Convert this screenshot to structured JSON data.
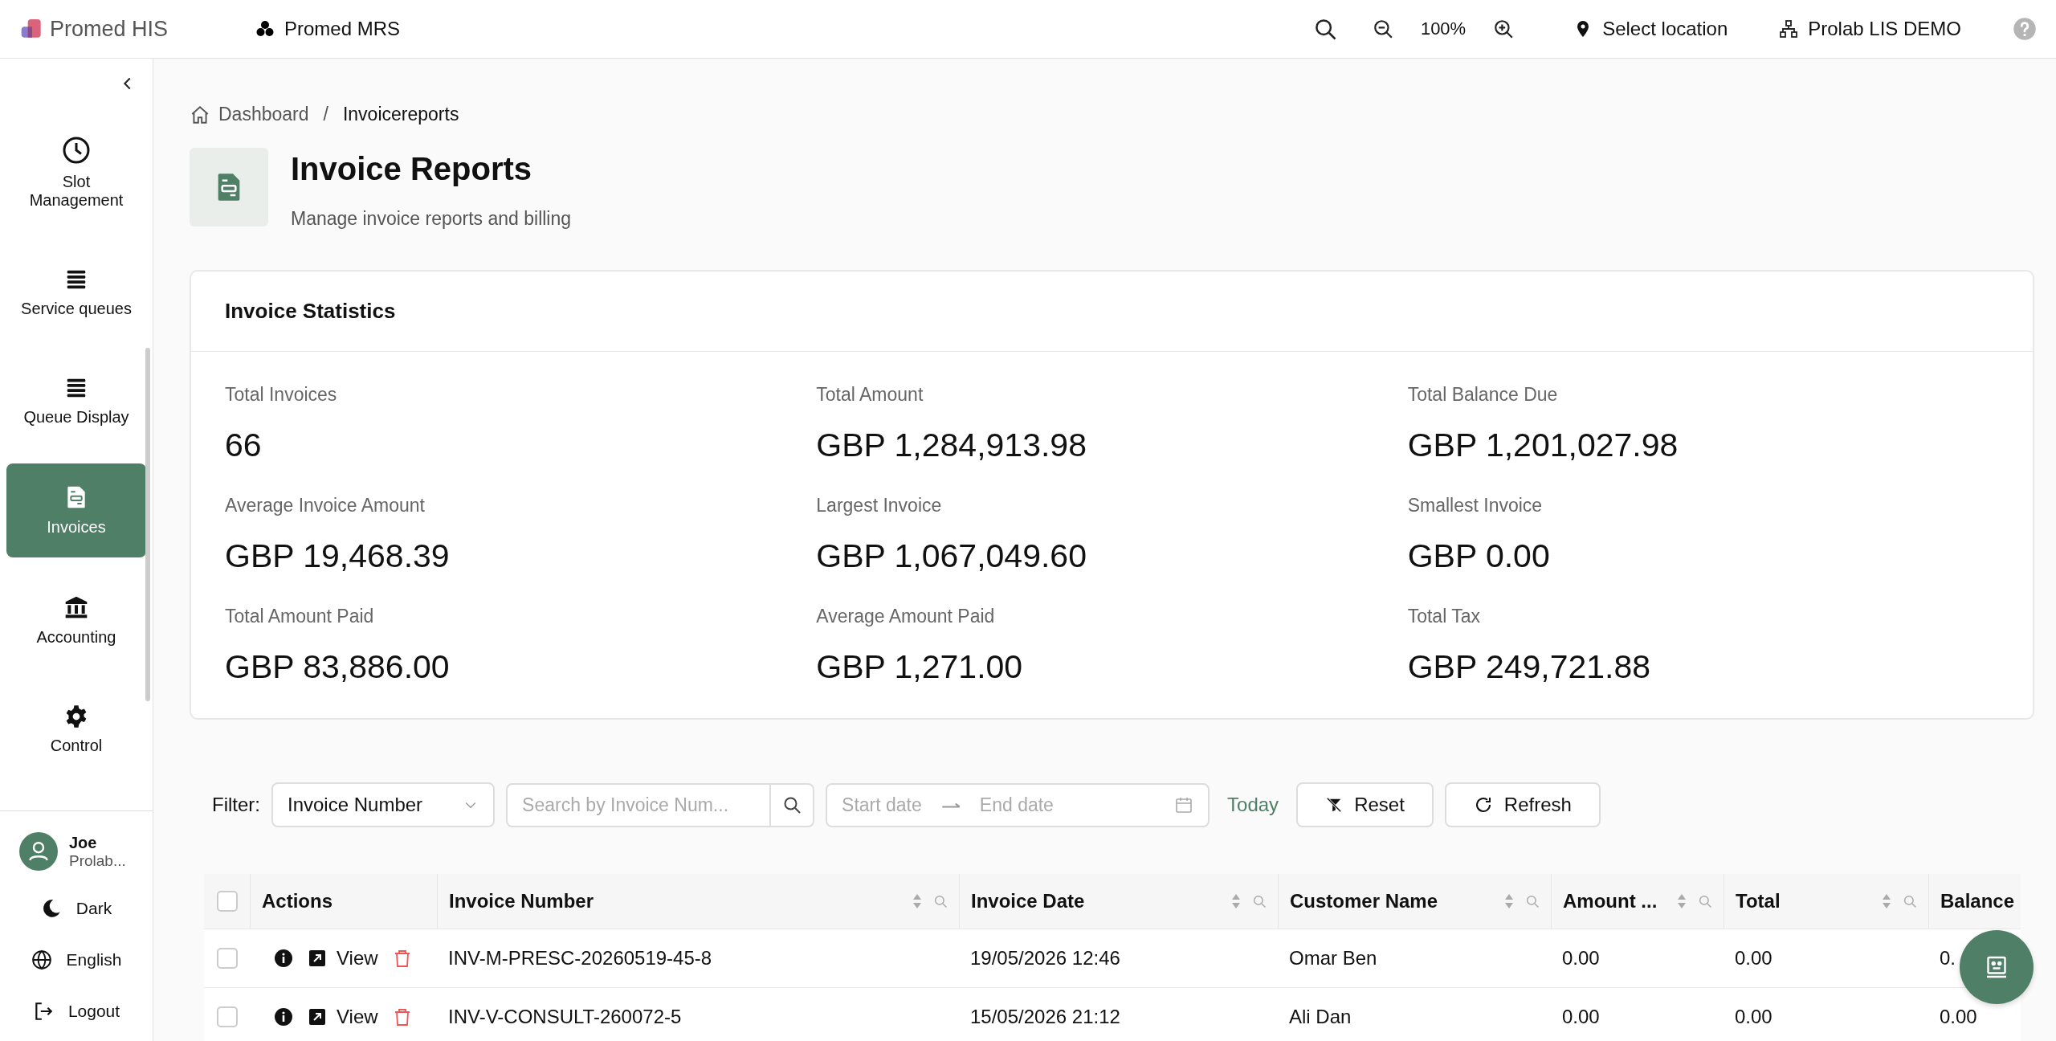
{
  "topbar": {
    "brand": "Promed HIS",
    "module": "Promed MRS",
    "zoom": "100%",
    "location": "Select location",
    "lab": "Prolab LIS DEMO"
  },
  "sidebar": {
    "items": [
      {
        "label": "Slot Management",
        "selected": false
      },
      {
        "label": "Service queues",
        "selected": false
      },
      {
        "label": "Queue Display",
        "selected": false
      },
      {
        "label": "Invoices",
        "selected": true
      },
      {
        "label": "Accounting",
        "selected": false
      },
      {
        "label": "Control",
        "selected": false
      }
    ],
    "user": {
      "name": "Joe",
      "org": "Prolab..."
    },
    "footer": [
      {
        "label": "Dark"
      },
      {
        "label": "English"
      },
      {
        "label": "Logout"
      }
    ]
  },
  "breadcrumb": {
    "home": "Dashboard",
    "separator": "/",
    "current": "Invoicereports"
  },
  "page": {
    "title": "Invoice Reports",
    "subtitle": "Manage invoice reports and billing"
  },
  "stats": {
    "title": "Invoice Statistics",
    "items": [
      {
        "label": "Total Invoices",
        "value": "66"
      },
      {
        "label": "Total Amount",
        "value": "GBP 1,284,913.98"
      },
      {
        "label": "Total Balance Due",
        "value": "GBP 1,201,027.98"
      },
      {
        "label": "Average Invoice Amount",
        "value": "GBP 19,468.39"
      },
      {
        "label": "Largest Invoice",
        "value": "GBP 1,067,049.60"
      },
      {
        "label": "Smallest Invoice",
        "value": "GBP 0.00"
      },
      {
        "label": "Total Amount Paid",
        "value": "GBP 83,886.00"
      },
      {
        "label": "Average Amount Paid",
        "value": "GBP 1,271.00"
      },
      {
        "label": "Total Tax",
        "value": "GBP 249,721.88"
      }
    ]
  },
  "filter": {
    "label": "Filter:",
    "field": "Invoice Number",
    "search_placeholder": "Search by Invoice Num...",
    "start_placeholder": "Start date",
    "end_placeholder": "End date",
    "today": "Today",
    "reset": "Reset",
    "refresh": "Refresh"
  },
  "table": {
    "all_checked": false,
    "actions_header": "Actions",
    "columns": [
      {
        "label": "Invoice Number",
        "sortable": true
      },
      {
        "label": "Invoice Date",
        "sortable": true
      },
      {
        "label": "Customer Name",
        "sortable": true
      },
      {
        "label": "Amount ...",
        "sortable": true
      },
      {
        "label": "Total",
        "sortable": true
      },
      {
        "label": "Balance",
        "sortable": false
      }
    ],
    "rows": [
      {
        "checked": false,
        "view": "View",
        "cells": [
          "INV-M-PRESC-20260519-45-8",
          "19/05/2026 12:46",
          "Omar Ben",
          "0.00",
          "0.00",
          "0."
        ]
      },
      {
        "checked": false,
        "view": "View",
        "cells": [
          "INV-V-CONSULT-260072-5",
          "15/05/2026 21:12",
          "Ali Dan",
          "0.00",
          "0.00",
          "0.00"
        ]
      }
    ]
  }
}
